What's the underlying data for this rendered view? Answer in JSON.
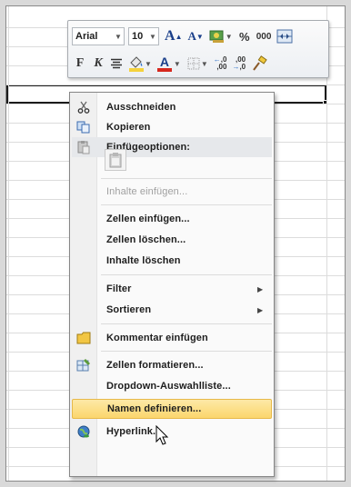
{
  "toolbar": {
    "font_name": "Arial",
    "font_size": "10",
    "grow_font": "A",
    "shrink_font": "A",
    "percent": "%",
    "thousands": "000",
    "bold": "F",
    "italic": "K",
    "font_color_letter": "A",
    "inc_decimal": ",0 ,00",
    "dec_decimal": ",00 ,0"
  },
  "menu": {
    "cut": "Ausschneiden",
    "copy": "Kopieren",
    "paste_options": "Einfügeoptionen:",
    "paste_special": "Inhalte einfügen...",
    "insert_cells": "Zellen einfügen...",
    "delete_cells": "Zellen löschen...",
    "clear_contents": "Inhalte löschen",
    "filter": "Filter",
    "sort": "Sortieren",
    "insert_comment": "Kommentar einfügen",
    "format_cells": "Zellen formatieren...",
    "dropdown_list": "Dropdown-Auswahlliste...",
    "define_name": "Namen definieren...",
    "hyperlink": "Hyperlink..."
  },
  "colors": {
    "hover_bg": "#fbd66d",
    "fill_color": "#f5d23c",
    "font_color": "#d6281e"
  }
}
